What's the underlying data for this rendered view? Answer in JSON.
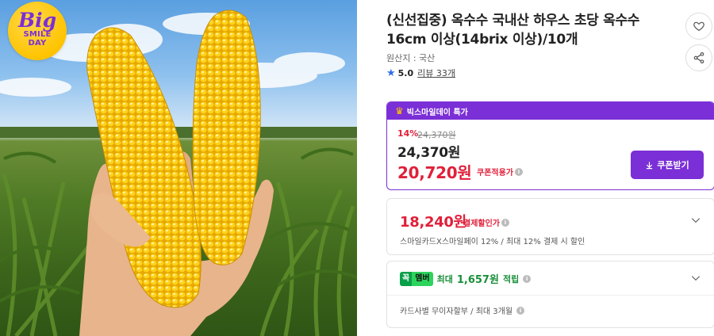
{
  "badge": {
    "line1": "Big",
    "line2": "SMILE",
    "line3": "DAY"
  },
  "product": {
    "title": "(신선집중) 옥수수 국내산 하우스 초당 옥수수 16cm 이상(14brix 이상)/10개",
    "origin": "원산지 : 국산",
    "rating_score": "5.0",
    "review_link": "리뷰 33개"
  },
  "deal": {
    "header": "빅스마일데이 특가",
    "discount_rate": "14%",
    "original_price": "24,370원",
    "price": "24,370원",
    "coupon_price": "20,720원",
    "coupon_label": "쿠폰적용가",
    "coupon_button": "쿠폰받기"
  },
  "card_payment": {
    "price": "18,240원",
    "label": "결제할인가",
    "description": "스마일카드X스마일페이 12% / 최대 12% 결제 시 할인"
  },
  "membership": {
    "badge_k": "꼭",
    "badge_m": "멤버",
    "text_prefix": "최대",
    "amount": "1,657원",
    "text_suffix": "적립",
    "installment": "카드사별 무이자할부 / 최대 3개월"
  },
  "colors": {
    "accent_purple": "#7b2fd6",
    "price_red": "#e0203a",
    "member_green": "#1a8f3a",
    "star_blue": "#2f6fe6"
  },
  "icons": [
    "heart-icon",
    "share-icon",
    "star-icon",
    "crown-icon",
    "download-icon",
    "info-icon",
    "chevron-down-icon"
  ]
}
